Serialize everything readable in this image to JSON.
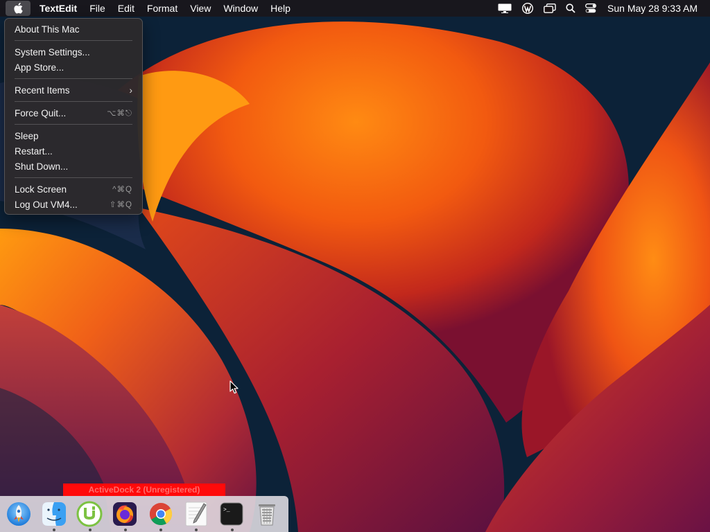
{
  "menubar": {
    "app_name": "TextEdit",
    "menus": [
      "File",
      "Edit",
      "Format",
      "View",
      "Window",
      "Help"
    ],
    "status_icons": [
      "display-icon",
      "wordpress-icon",
      "screen-mirroring-icon",
      "spotlight-search-icon",
      "control-center-icon"
    ],
    "clock": "Sun May 28  9:33 AM"
  },
  "apple_menu": {
    "items": [
      {
        "label": "About This Mac",
        "shortcut": ""
      },
      {
        "label": "System Settings...",
        "shortcut": ""
      },
      {
        "label": "App Store...",
        "shortcut": ""
      },
      {
        "label": "Recent Items",
        "shortcut": ""
      },
      {
        "label": "Force Quit...",
        "shortcut": "⌥⌘⎋"
      },
      {
        "label": "Sleep",
        "shortcut": ""
      },
      {
        "label": "Restart...",
        "shortcut": ""
      },
      {
        "label": "Shut Down...",
        "shortcut": ""
      },
      {
        "label": "Lock Screen",
        "shortcut": "^⌘Q"
      },
      {
        "label": "Log Out VM4...",
        "shortcut": "⇧⌘Q"
      }
    ]
  },
  "dock": {
    "banner": "ActiveDock 2 (Unregistered)",
    "items": [
      {
        "icon": "launchpad-rocket-icon",
        "running": false
      },
      {
        "icon": "finder-icon",
        "running": true
      },
      {
        "icon": "utorrent-icon",
        "running": true
      },
      {
        "icon": "firefox-icon",
        "running": true
      },
      {
        "icon": "chrome-icon",
        "running": true
      },
      {
        "icon": "textedit-icon",
        "running": true
      },
      {
        "icon": "terminal-icon",
        "running": true
      },
      {
        "icon": "trash-icon",
        "running": false
      }
    ]
  },
  "colors": {
    "banner_bg": "#ff0a0a",
    "wallpaper_orange": "#ff7a10",
    "wallpaper_navy": "#0c2238"
  }
}
